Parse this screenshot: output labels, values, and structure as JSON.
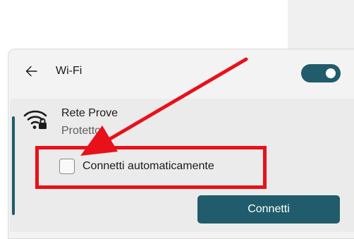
{
  "wifi_panel": {
    "title": "Wi-Fi",
    "wifi_enabled": true
  },
  "network": {
    "name": "Rete Prove",
    "status": "Protetto",
    "secured": true
  },
  "connect_automatically": {
    "label": "Connetti automaticamente",
    "checked": false
  },
  "connect_button": {
    "label": "Connetti"
  },
  "colors": {
    "accent": "#205c6b",
    "annotation": "#e8111a",
    "panel_background": "#f3f3f3",
    "card_background": "#ebebeb"
  },
  "icons": {
    "back": "arrow-left-icon",
    "network": "wifi-locked-icon"
  }
}
